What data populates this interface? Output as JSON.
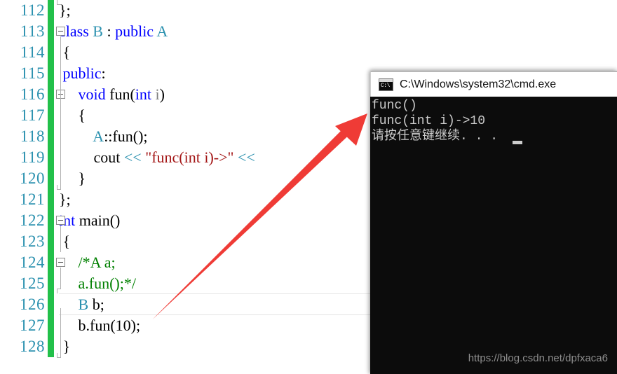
{
  "editor": {
    "name": "visual-studio-code-editor",
    "first_line_number": 112,
    "colors": {
      "background": "#ffffff",
      "line_number": "#2b91af",
      "change_bar_green": "#22c04a",
      "keyword": "#0000ff",
      "type": "#2b91af",
      "string": "#a31515",
      "comment": "#008000",
      "text": "#000000"
    },
    "current_line": 126,
    "lines": [
      {
        "number": "112",
        "text": "};"
      },
      {
        "number": "113",
        "text": "class B : public A"
      },
      {
        "number": "114",
        "text": " {"
      },
      {
        "number": "115",
        "text": " public:"
      },
      {
        "number": "116",
        "text": "     void fun(int i)"
      },
      {
        "number": "117",
        "text": "     {"
      },
      {
        "number": "118",
        "text": "         A::fun();"
      },
      {
        "number": "119",
        "text": "         cout << \"func(int i)->\" <<"
      },
      {
        "number": "120",
        "text": "     }"
      },
      {
        "number": "121",
        "text": "};"
      },
      {
        "number": "122",
        "text": "int main()"
      },
      {
        "number": "123",
        "text": " {"
      },
      {
        "number": "124",
        "text": "     /*A a;"
      },
      {
        "number": "125",
        "text": "     a.fun();*/"
      },
      {
        "number": "126",
        "text": "     B b;"
      },
      {
        "number": "127",
        "text": "     b.fun(10);"
      },
      {
        "number": "128",
        "text": " }"
      }
    ]
  },
  "console": {
    "title": "C:\\Windows\\system32\\cmd.exe",
    "icon": "cmd-icon",
    "icon_prompt_text": "C:\\",
    "background": "#0c0c0c",
    "foreground": "#cccccc",
    "output_lines": [
      "func()",
      "func(int i)->10",
      "请按任意键继续. . ."
    ]
  },
  "annotation": {
    "arrow_color": "#ef3b36",
    "arrow_from": "line-126-B-b",
    "arrow_to": "console-output-line-2"
  },
  "watermark": {
    "text": "https://blog.csdn.net/dpfxaca6"
  }
}
